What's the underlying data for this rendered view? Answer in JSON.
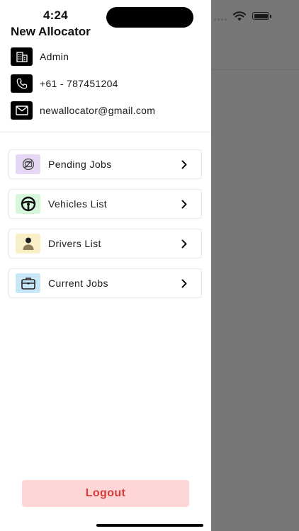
{
  "status_bar": {
    "time": "4:24"
  },
  "profile": {
    "name": "New Allocator",
    "role": "Admin",
    "phone": "+61 - 787451204",
    "email": "newallocator@gmail.com"
  },
  "menu": {
    "items": [
      {
        "label": "Pending Jobs",
        "icon": "pending-jobs-icon",
        "color": "#e6d7f5"
      },
      {
        "label": "Vehicles List",
        "icon": "steering-wheel-icon",
        "color": "#d6f7da"
      },
      {
        "label": "Drivers List",
        "icon": "driver-icon",
        "color": "#faf0c8"
      },
      {
        "label": "Current Jobs",
        "icon": "briefcase-icon",
        "color": "#c9e8f7"
      }
    ]
  },
  "logout": {
    "label": "Logout"
  },
  "colors": {
    "logout_bg": "#ffd6d6",
    "logout_text": "#d63a3a",
    "overlay": "#777777"
  }
}
